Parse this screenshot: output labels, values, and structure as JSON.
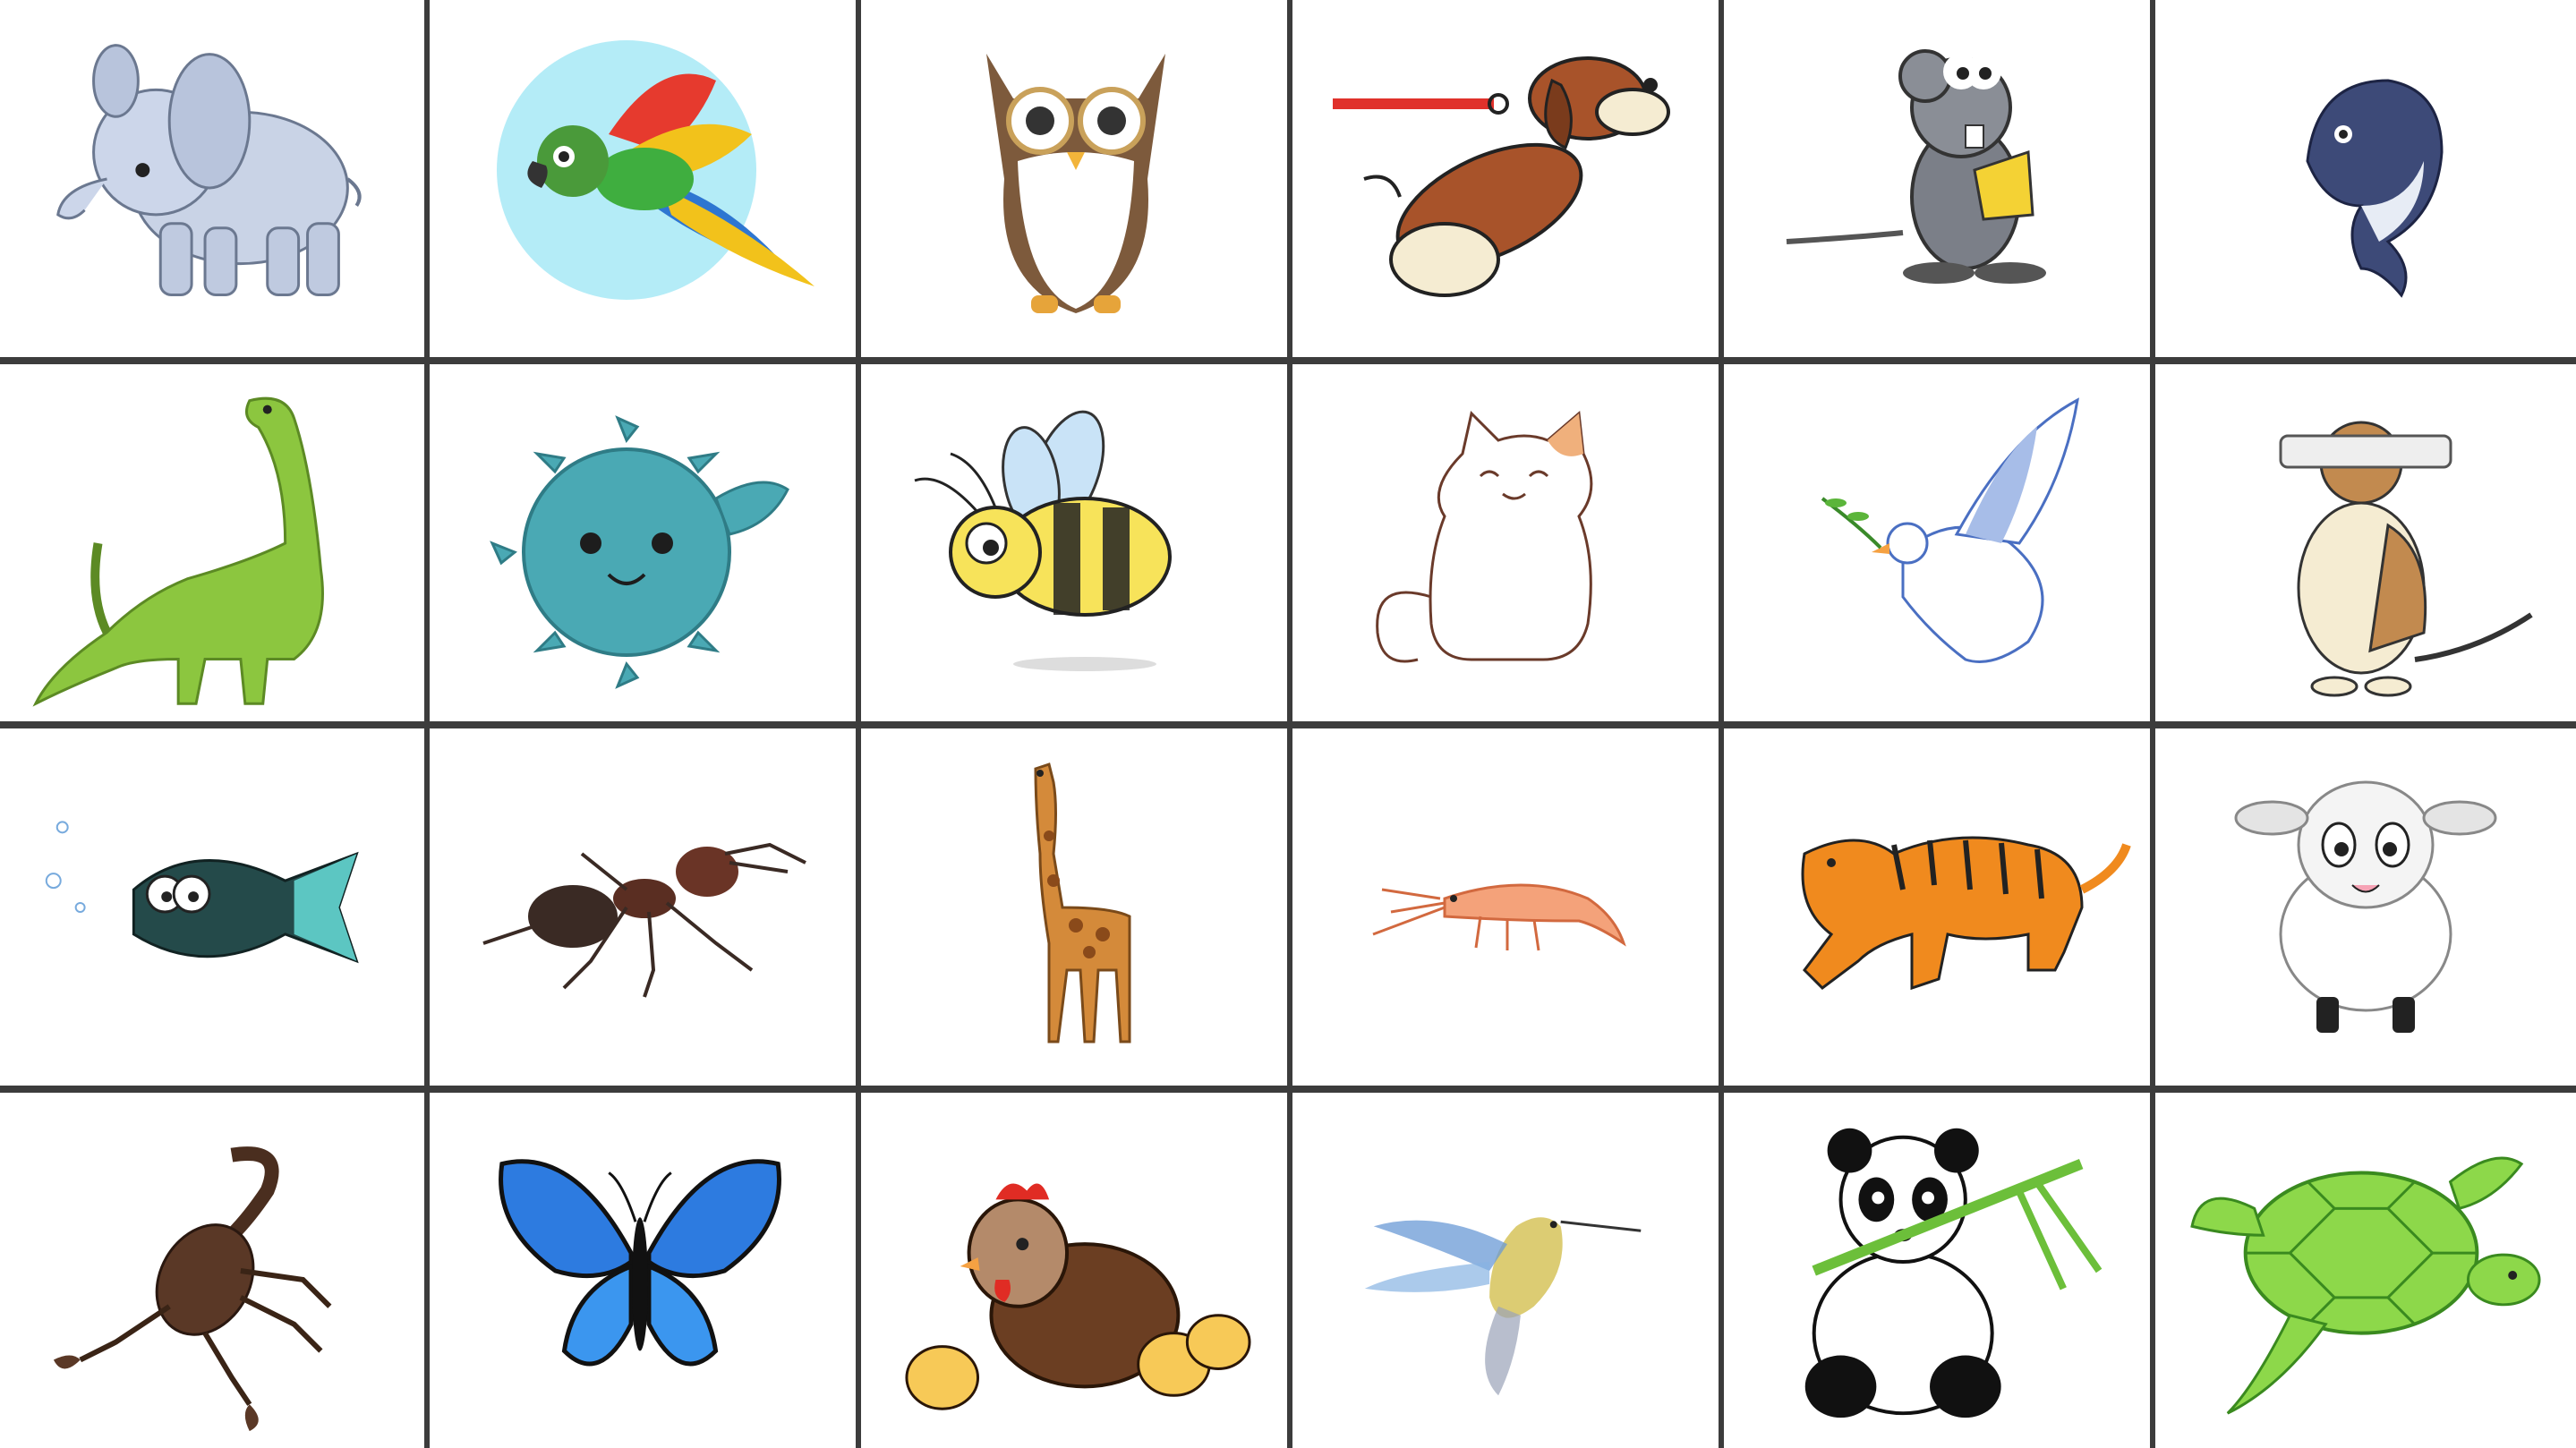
{
  "grid": {
    "rows": 4,
    "columns": 6,
    "background": "#3c3c3c",
    "tile_background": "#ffffff"
  },
  "tiles": [
    {
      "icon": "elephant-icon"
    },
    {
      "icon": "parrot-icon"
    },
    {
      "icon": "owl-icon"
    },
    {
      "icon": "dog-on-leash-icon"
    },
    {
      "icon": "mouse-with-cheese-icon"
    },
    {
      "icon": "dolphin-icon"
    },
    {
      "icon": "dinosaur-icon"
    },
    {
      "icon": "pufferfish-icon"
    },
    {
      "icon": "bee-icon"
    },
    {
      "icon": "cat-icon"
    },
    {
      "icon": "dove-icon"
    },
    {
      "icon": "dog-with-newspaper-icon"
    },
    {
      "icon": "piranha-icon"
    },
    {
      "icon": "ant-icon"
    },
    {
      "icon": "giraffe-icon"
    },
    {
      "icon": "shrimp-icon"
    },
    {
      "icon": "tiger-icon"
    },
    {
      "icon": "sheep-icon"
    },
    {
      "icon": "scorpion-icon"
    },
    {
      "icon": "butterfly-icon"
    },
    {
      "icon": "hen-with-chicks-icon"
    },
    {
      "icon": "hummingbird-icon"
    },
    {
      "icon": "panda-icon"
    },
    {
      "icon": "sea-turtle-icon"
    }
  ]
}
